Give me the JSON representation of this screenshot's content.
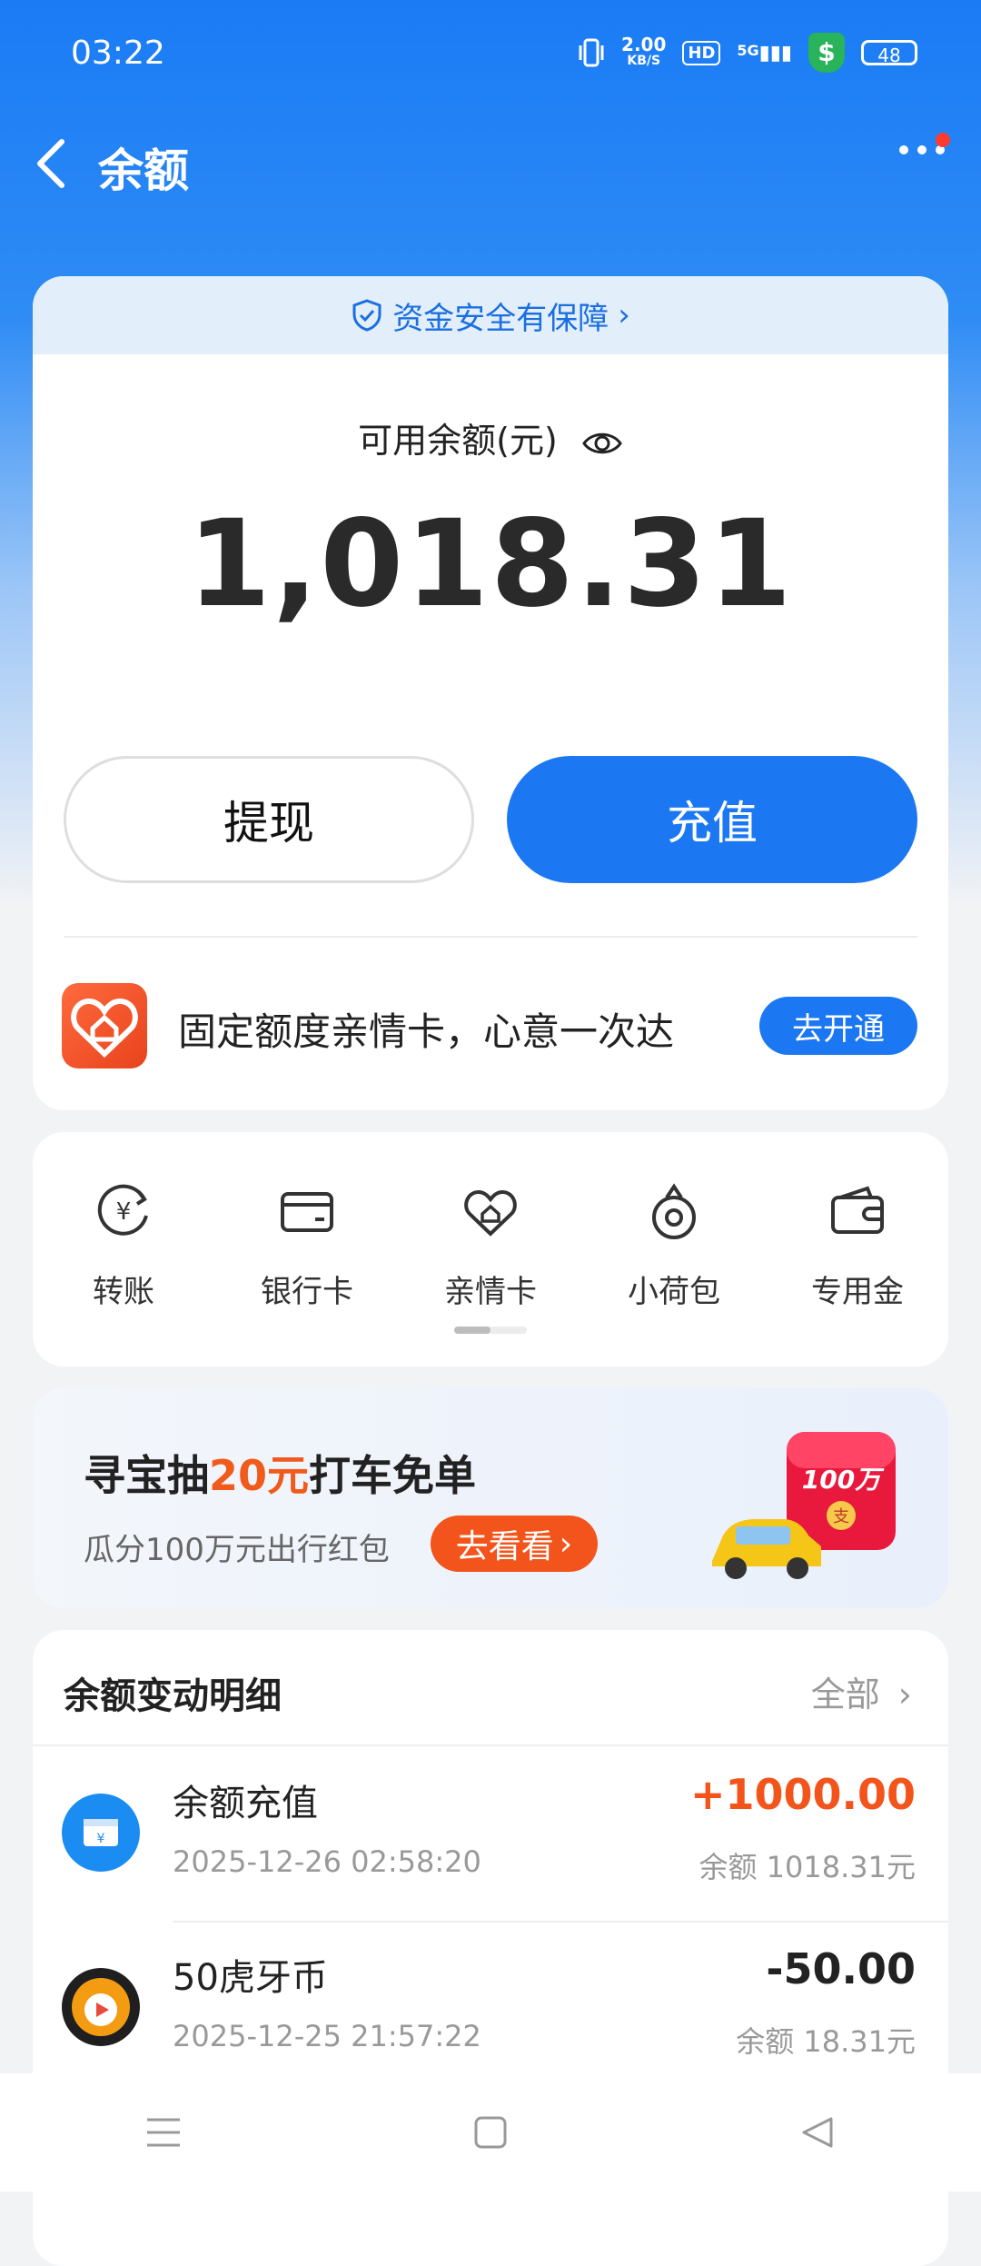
{
  "status_bar": {
    "time": "03:22",
    "net_speed_value": "2.00",
    "net_speed_unit": "KB/S",
    "hd": "HD",
    "network": "5G",
    "shield_symbol": "$",
    "battery": "48"
  },
  "header": {
    "title": "余额"
  },
  "balance_card": {
    "safety_text": "资金安全有保障",
    "available_label": "可用余额(元)",
    "amount": "1,018.31",
    "withdraw_label": "提现",
    "recharge_label": "充值",
    "family_card_text": "固定额度亲情卡，心意一次达",
    "family_card_button": "去开通"
  },
  "quick_actions": [
    {
      "label": "转账",
      "icon": "transfer-icon"
    },
    {
      "label": "银行卡",
      "icon": "bank-card-icon"
    },
    {
      "label": "亲情卡",
      "icon": "family-card-icon"
    },
    {
      "label": "小荷包",
      "icon": "pouch-icon"
    },
    {
      "label": "专用金",
      "icon": "wallet-icon"
    }
  ],
  "promo": {
    "title_prefix": "寻宝抽",
    "title_highlight": "20元",
    "title_suffix": "打车免单",
    "subtitle": "瓜分100万元出行红包",
    "button": "去看看",
    "art_text": "100万",
    "art_badge": "支"
  },
  "transactions": {
    "header": "余额变动明细",
    "all_label": "全部",
    "items": [
      {
        "name": "余额充值",
        "time": "2025-12-26 02:58:20",
        "amount": "+1000.00",
        "balance": "余额 1018.31元",
        "amount_color": "#f2541b"
      },
      {
        "name": "50虎牙币",
        "time": "2025-12-25 21:57:22",
        "amount": "-50.00",
        "balance": "余额 18.31元",
        "amount_color": "#222222"
      }
    ]
  },
  "colors": {
    "brand_blue": "#1b78f2",
    "accent_orange": "#f2541b"
  }
}
